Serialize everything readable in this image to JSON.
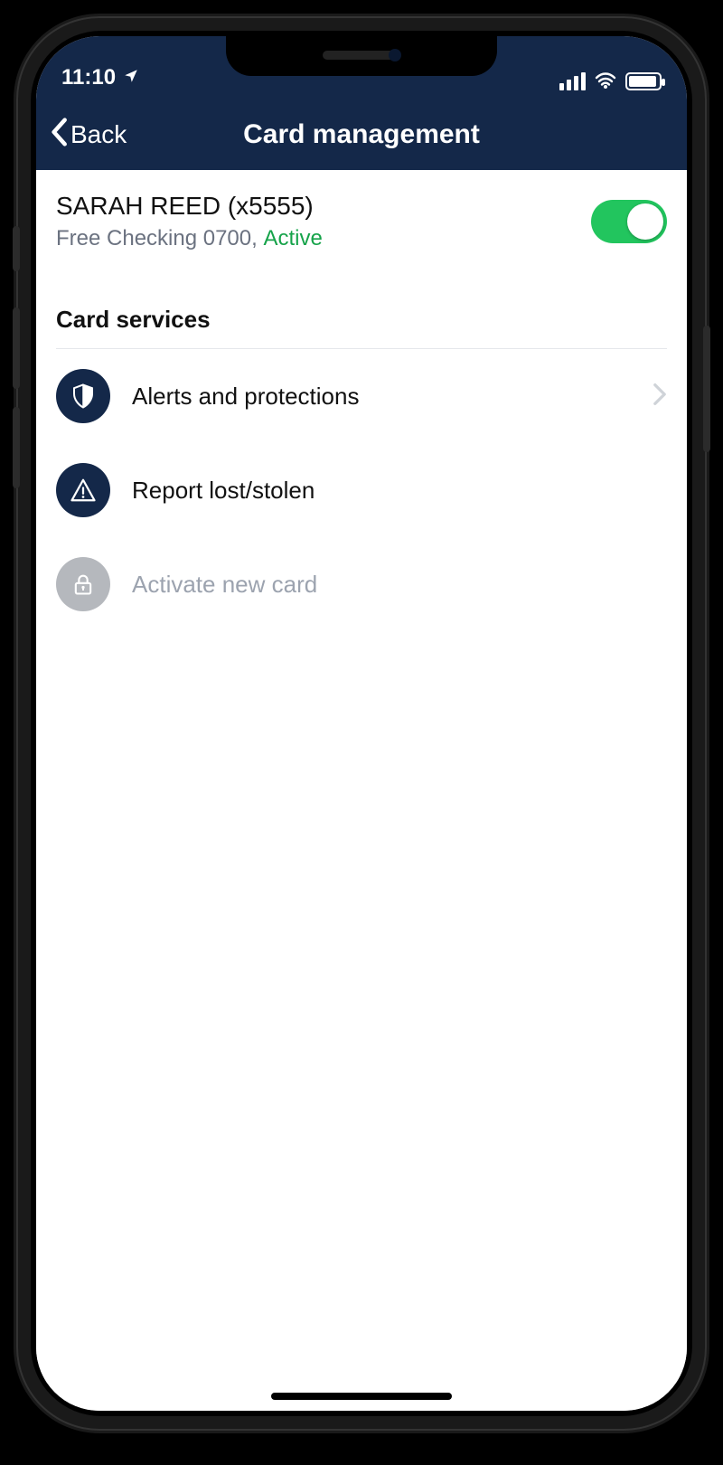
{
  "status": {
    "time": "11:10",
    "location_icon": "location-arrow"
  },
  "nav": {
    "back_label": "Back",
    "title": "Card management"
  },
  "card": {
    "holder_line": "SARAH REED (x5555)",
    "account_label": "Free Checking 0700,",
    "status_label": "Active",
    "toggle_on": true
  },
  "section": {
    "title": "Card services",
    "items": [
      {
        "icon": "shield-icon",
        "label": "Alerts and protections",
        "enabled": true,
        "chevron": true
      },
      {
        "icon": "alert-triangle-icon",
        "label": "Report lost/stolen",
        "enabled": true,
        "chevron": false
      },
      {
        "icon": "lock-icon",
        "label": "Activate new card",
        "enabled": false,
        "chevron": false
      }
    ]
  }
}
